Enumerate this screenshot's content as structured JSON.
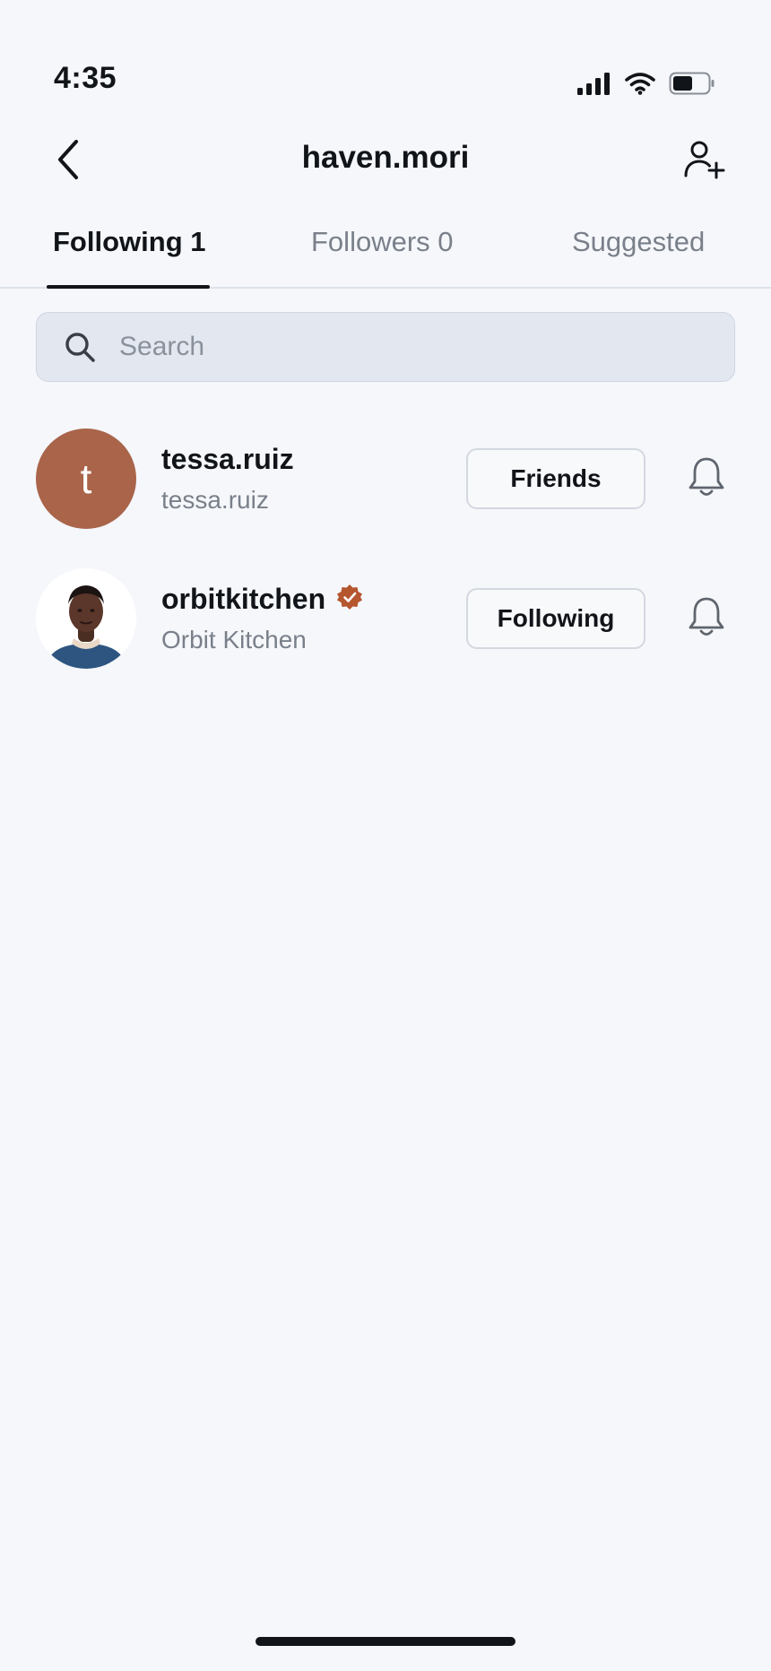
{
  "status_bar": {
    "time": "4:35",
    "icons": [
      "signal-icon",
      "wifi-icon",
      "battery-icon"
    ]
  },
  "header": {
    "title": "haven.mori",
    "back_icon": "chevron-left-icon",
    "add_user_icon": "add-user-icon"
  },
  "tabs": [
    {
      "label": "Following 1",
      "active": true
    },
    {
      "label": "Followers 0",
      "active": false
    },
    {
      "label": "Suggested",
      "active": false
    }
  ],
  "search": {
    "placeholder": "Search",
    "value": ""
  },
  "following": [
    {
      "username": "tessa.ruiz",
      "subtitle": "tessa.ruiz",
      "avatar_letter": "t",
      "avatar_color": "#a9644a",
      "verified": false,
      "button_label": "Friends"
    },
    {
      "username": "orbitkitchen",
      "subtitle": "Orbit Kitchen",
      "avatar_letter": "",
      "verified": true,
      "verified_color": "#b5562f",
      "button_label": "Following"
    }
  ]
}
